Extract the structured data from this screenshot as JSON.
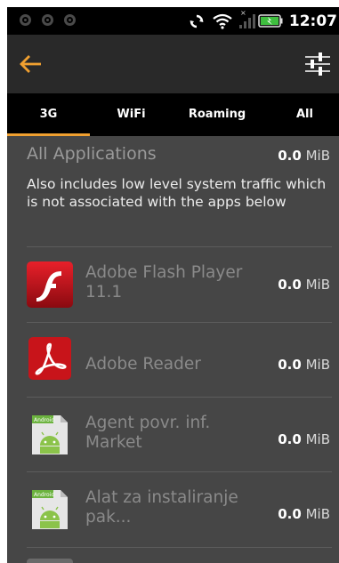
{
  "status_bar": {
    "time": "12:07",
    "battery_color": "#3fbf3f"
  },
  "accent_color": "#f0a030",
  "tabs": [
    {
      "label": "3G",
      "selected": true
    },
    {
      "label": "WiFi",
      "selected": false
    },
    {
      "label": "Roaming",
      "selected": false
    },
    {
      "label": "All",
      "selected": false
    }
  ],
  "summary": {
    "title": "All Applications",
    "value": "0.0",
    "unit": "MiB",
    "description": "Also includes low level system traffic which is not associated with the apps below"
  },
  "apps": [
    {
      "name": "Adobe Flash Player 11.1",
      "value": "0.0",
      "unit": "MiB",
      "icon": "adobe-flash-icon"
    },
    {
      "name": "Adobe Reader",
      "value": "0.0",
      "unit": "MiB",
      "icon": "adobe-reader-icon"
    },
    {
      "name": "Agent povr. inf. Market",
      "value": "0.0",
      "unit": "MiB",
      "icon": "android-app-icon"
    },
    {
      "name": "Alat za instaliranje pak...",
      "value": "0.0",
      "unit": "MiB",
      "icon": "android-app-icon"
    }
  ],
  "android_icon_label": "Android"
}
